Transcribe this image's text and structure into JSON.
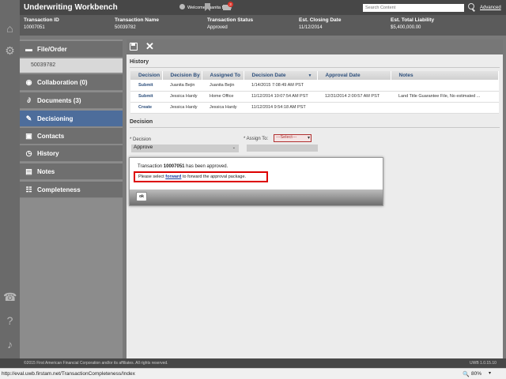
{
  "header": {
    "app_title": "Underwriting Workbench",
    "welcome": "Welcome Juanita Bejin",
    "mail_count": "3",
    "search_placeholder": "Search Content",
    "advanced_label": "Advanced"
  },
  "transaction": {
    "columns": [
      {
        "label": "Transaction ID",
        "value": "10007051"
      },
      {
        "label": "Transaction Name",
        "value": "50039782"
      },
      {
        "label": "Transaction Status",
        "value": "Approved"
      },
      {
        "label": "Est. Closing Date",
        "value": "11/12/2014"
      },
      {
        "label": "Est. Total Liability",
        "value": "$5,400,000.00"
      }
    ]
  },
  "sidebar": {
    "items": [
      {
        "label": "File/Order",
        "icon": "folder-icon"
      },
      {
        "label": "Collaboration (0)",
        "icon": "collaboration-icon"
      },
      {
        "label": "Documents (3)",
        "icon": "paperclip-icon"
      },
      {
        "label": "Decisioning",
        "icon": "gavel-icon"
      },
      {
        "label": "Contacts",
        "icon": "contacts-icon"
      },
      {
        "label": "History",
        "icon": "clock-icon"
      },
      {
        "label": "Notes",
        "icon": "notes-icon"
      },
      {
        "label": "Completeness",
        "icon": "checklist-icon"
      }
    ],
    "order_number": "50039782"
  },
  "main": {
    "history_title": "History",
    "history_headers": [
      "Decision",
      "Decision By",
      "Assigned To",
      "Decision Date",
      "Approval Date",
      "Notes"
    ],
    "history_rows": [
      [
        "Submit",
        "Juanita Bejin",
        "Juanita Bejin",
        "1/14/2015 7:08:49 AM PST",
        "",
        ""
      ],
      [
        "Submit",
        "Jessica Hardy",
        "Home Office",
        "11/12/2014 10:07:54 AM PST",
        "12/31/2014 2:00:57 AM PST",
        "Land Title Guarantee File, No estimated ..."
      ],
      [
        "Create",
        "Jessica Hardy",
        "Jessica Hardy",
        "11/12/2014 9:54:18 AM PST",
        "",
        ""
      ]
    ],
    "decision_title": "Decision",
    "decision_label": "* Decision",
    "decision_value": "Approve",
    "assign_label": "* Assign To:",
    "assign_value": "---Select---"
  },
  "dialog": {
    "message_prefix": "Transaction ",
    "message_id": "10007051",
    "message_suffix": " has been approved.",
    "instr_prefix": "Please select ",
    "instr_link": "forward",
    "instr_suffix": " to forward the approval package.",
    "ok_label": "ok"
  },
  "footer": {
    "copyright": "©2015 First American Financial Corporation and/or its affiliates. All rights reserved.",
    "version": "UWB 1.0.15.10"
  },
  "statusbar": {
    "url": "http://eval.uwb.firstam.net/TransactionCompleteness/Index",
    "zoom": "80%"
  }
}
